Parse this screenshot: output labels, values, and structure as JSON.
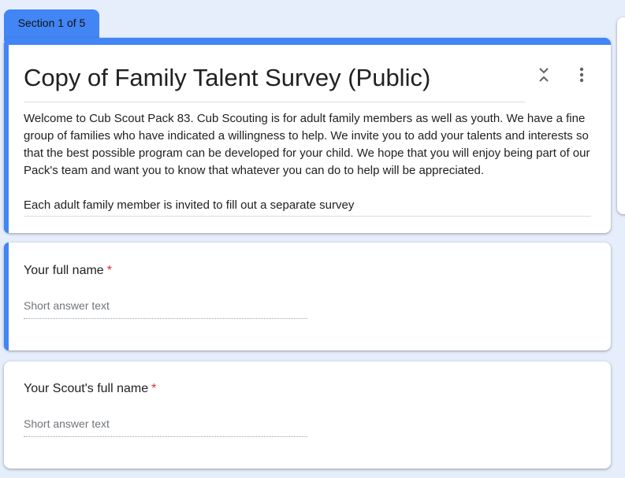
{
  "section_tab": {
    "label": "Section 1 of 5"
  },
  "header": {
    "title": "Copy of Family Talent Survey (Public)",
    "description": [
      "Welcome to Cub Scout Pack 83. Cub Scouting is for adult family members as well as youth. We have a fine group of families who have indicated a willingness to help. We invite you to add your talents and interests so that the best possible program can be developed for your child. We hope that you will enjoy being part of our Pack's team and want you to know that whatever you can do to help will be appreciated.",
      "Each adult family member is invited to fill out a separate survey"
    ],
    "collapse_icon": "collapse-icon",
    "more_icon": "more-vert-icon"
  },
  "questions": [
    {
      "title": "Your full name",
      "required_mark": "*",
      "placeholder": "Short answer text"
    },
    {
      "title": "Your Scout's full name",
      "required_mark": "*",
      "placeholder": "Short answer text"
    }
  ],
  "colors": {
    "accent": "#4285f4",
    "background": "#e6edfb",
    "required": "#d93025"
  }
}
